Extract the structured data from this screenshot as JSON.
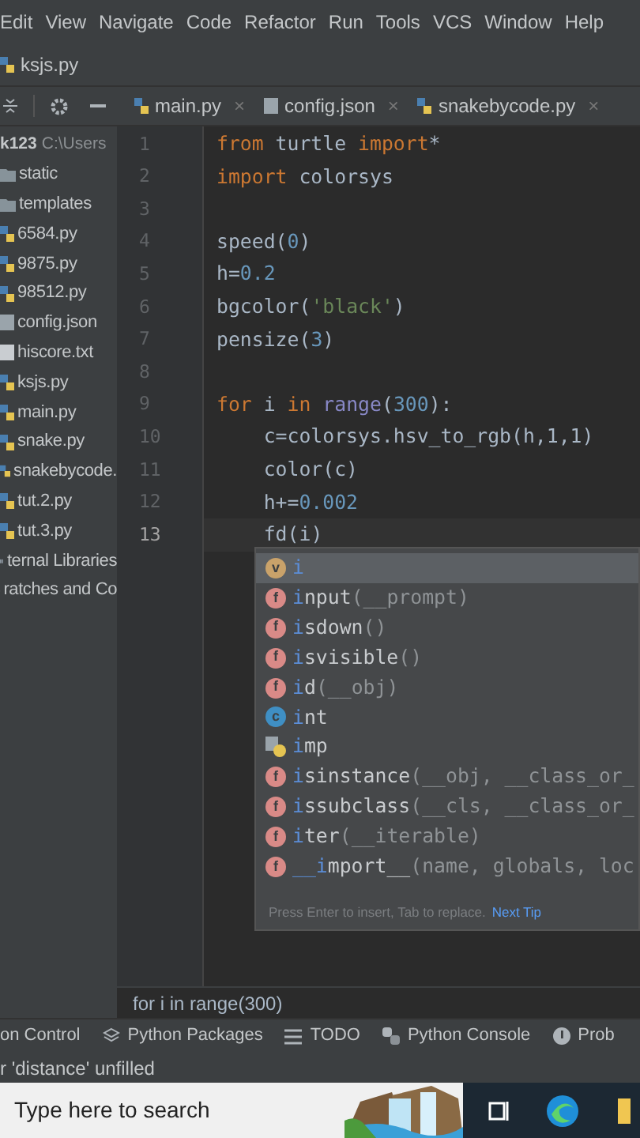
{
  "menu": [
    "Edit",
    "View",
    "Navigate",
    "Code",
    "Refactor",
    "Run",
    "Tools",
    "VCS",
    "Window",
    "Help"
  ],
  "breadcrumb": "ksjs.py",
  "tabs": [
    {
      "label": "main.py",
      "kind": "python",
      "close": "×",
      "selected": false
    },
    {
      "label": "config.json",
      "kind": "json",
      "close": "×",
      "selected": false
    },
    {
      "label": "snakebycode.py",
      "kind": "python",
      "close": "×",
      "selected": false
    }
  ],
  "project": {
    "root": "k123",
    "path": "C:\\Users",
    "items": [
      {
        "label": "static",
        "kind": "folder"
      },
      {
        "label": "templates",
        "kind": "folder"
      },
      {
        "label": "6584.py",
        "kind": "python"
      },
      {
        "label": "9875.py",
        "kind": "python"
      },
      {
        "label": "98512.py",
        "kind": "python"
      },
      {
        "label": "config.json",
        "kind": "json"
      },
      {
        "label": "hiscore.txt",
        "kind": "text"
      },
      {
        "label": "ksjs.py",
        "kind": "python"
      },
      {
        "label": "main.py",
        "kind": "python"
      },
      {
        "label": "snake.py",
        "kind": "python"
      },
      {
        "label": "snakebycode.",
        "kind": "python"
      },
      {
        "label": "tut.2.py",
        "kind": "python"
      },
      {
        "label": "tut.3.py",
        "kind": "python"
      },
      {
        "label": "ternal Libraries",
        "kind": "libraries"
      },
      {
        "label": "ratches and Co",
        "kind": "scratches"
      }
    ]
  },
  "code": [
    {
      "number": "1",
      "current": false,
      "tokens": [
        {
          "text": "from",
          "kind": "keyword"
        },
        {
          "text": " turtle ",
          "kind": "plain"
        },
        {
          "text": "import",
          "kind": "keyword"
        },
        {
          "text": "*",
          "kind": "plain"
        }
      ]
    },
    {
      "number": "2",
      "current": false,
      "tokens": [
        {
          "text": "import",
          "kind": "keyword"
        },
        {
          "text": " colorsys",
          "kind": "plain"
        }
      ]
    },
    {
      "number": "3",
      "current": false
    },
    {
      "number": "4",
      "current": false,
      "tokens": [
        {
          "text": "speed(",
          "kind": "plain"
        },
        {
          "text": "0",
          "kind": "number"
        },
        {
          "text": ")",
          "kind": "plain"
        }
      ]
    },
    {
      "number": "5",
      "current": false,
      "tokens": [
        {
          "text": "h=",
          "kind": "plain"
        },
        {
          "text": "0.2",
          "kind": "number"
        }
      ]
    },
    {
      "number": "6",
      "current": false,
      "tokens": [
        {
          "text": "bgcolor(",
          "kind": "plain"
        },
        {
          "text": "'black'",
          "kind": "string"
        },
        {
          "text": ")",
          "kind": "plain"
        }
      ]
    },
    {
      "number": "7",
      "current": false,
      "tokens": [
        {
          "text": "pensize(",
          "kind": "plain"
        },
        {
          "text": "3",
          "kind": "number"
        },
        {
          "text": ")",
          "kind": "plain"
        }
      ]
    },
    {
      "number": "8",
      "current": false
    },
    {
      "number": "9",
      "current": false,
      "tokens": [
        {
          "text": "for",
          "kind": "keyword"
        },
        {
          "text": " i ",
          "kind": "plain"
        },
        {
          "text": "in",
          "kind": "keyword"
        },
        {
          "text": " range",
          "kind": "builtin"
        },
        {
          "text": "(",
          "kind": "plain"
        },
        {
          "text": "300",
          "kind": "number"
        },
        {
          "text": "):",
          "kind": "plain"
        }
      ]
    },
    {
      "number": "10",
      "current": false,
      "tokens": [
        {
          "text": "    c=colorsys.hsv_to_rgb(h,1,1)",
          "kind": "plain"
        }
      ]
    },
    {
      "number": "11",
      "current": false,
      "tokens": [
        {
          "text": "    color(c)",
          "kind": "plain"
        }
      ]
    },
    {
      "number": "12",
      "current": false,
      "tokens": [
        {
          "text": "    h+=",
          "kind": "plain"
        },
        {
          "text": "0.002",
          "kind": "number"
        }
      ]
    },
    {
      "number": "13",
      "current": true,
      "tokens": [
        {
          "text": "    fd(",
          "kind": "plain"
        },
        {
          "text": "i",
          "kind": "plain"
        },
        {
          "text": ")",
          "kind": "plain"
        }
      ]
    }
  ],
  "completion": {
    "items": [
      {
        "kind": "variable",
        "badge": "v",
        "match": "i",
        "selected": true
      },
      {
        "kind": "function",
        "badge": "f",
        "match": "i",
        "rest": "nput",
        "params": "(__prompt)",
        "selected": false
      },
      {
        "kind": "function",
        "badge": "f",
        "match": "i",
        "rest": "sdown",
        "params": "()",
        "selected": false
      },
      {
        "kind": "function",
        "badge": "f",
        "match": "i",
        "rest": "svisible",
        "params": "()",
        "selected": false
      },
      {
        "kind": "function",
        "badge": "f",
        "match": "i",
        "rest": "d",
        "params": "(__obj)",
        "selected": false
      },
      {
        "kind": "class",
        "badge": "c",
        "match": "i",
        "rest": "nt",
        "selected": false
      },
      {
        "kind": "module",
        "match": "i",
        "rest": "mp",
        "selected": false
      },
      {
        "kind": "function",
        "badge": "f",
        "match": "i",
        "rest": "sinstance",
        "params": "(__obj, __class_or_",
        "selected": false
      },
      {
        "kind": "function",
        "badge": "f",
        "match": "i",
        "rest": "ssubclass",
        "params": "(__cls, __class_or_",
        "selected": false
      },
      {
        "kind": "function",
        "badge": "f",
        "match": "i",
        "rest": "ter",
        "params": "(__iterable)",
        "selected": false
      },
      {
        "kind": "function",
        "badge": "f",
        "match": "__i",
        "rest": "mport__",
        "params": "(name, globals, loc",
        "selected": false
      }
    ],
    "hint": "Press Enter to insert, Tab to replace.",
    "tip": "Next Tip"
  },
  "context": "for i in range(300)",
  "toolbar": [
    {
      "label": "on Control",
      "kind": "plain"
    },
    {
      "label": "Python Packages",
      "kind": "packages"
    },
    {
      "label": "TODO",
      "kind": "todo"
    },
    {
      "label": "Python Console",
      "kind": "console"
    },
    {
      "label": "Prob",
      "kind": "problems"
    }
  ],
  "status": "r 'distance' unfilled",
  "taskbar": {
    "search": {
      "placeholder": "Type here to search"
    }
  }
}
